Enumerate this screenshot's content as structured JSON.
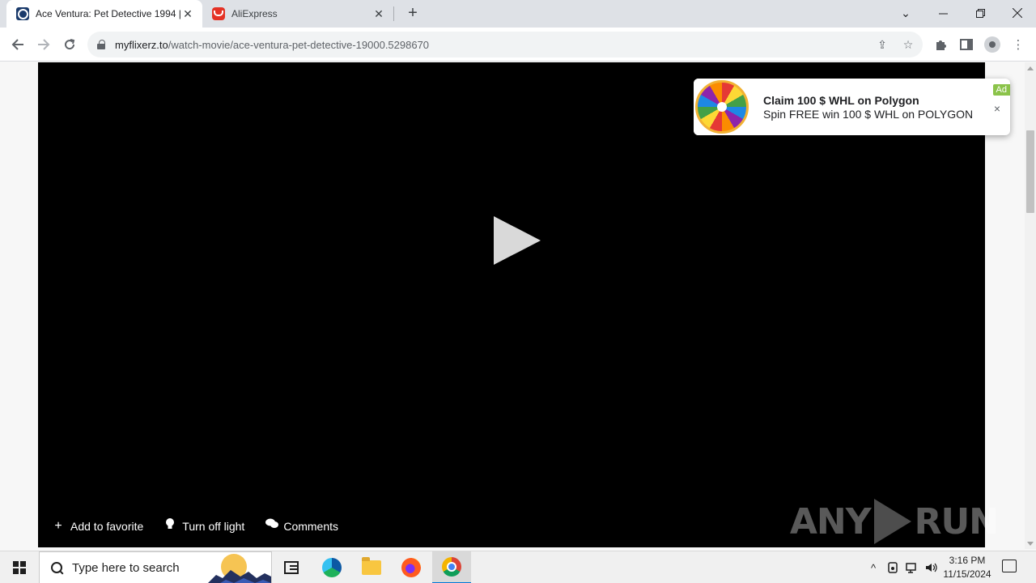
{
  "browser": {
    "tabs": [
      {
        "label": "Ace Ventura: Pet Detective 1994 |",
        "favicon": "movie-site-icon",
        "active": true
      },
      {
        "label": "AliExpress",
        "favicon": "aliexpress-icon",
        "active": false
      }
    ],
    "new_tab_label": "+",
    "url_domain": "myflixerz.to",
    "url_path": "/watch-movie/ace-ventura-pet-detective-19000.5298670"
  },
  "player": {
    "actions": [
      {
        "label": "Add to favorite",
        "icon": "plus-icon"
      },
      {
        "label": "Turn off light",
        "icon": "lightbulb-icon"
      },
      {
        "label": "Comments",
        "icon": "comments-icon"
      }
    ],
    "watermark_left": "ANY",
    "watermark_right": "RUN"
  },
  "ad": {
    "title": "Claim  100 $ WHL on Polygon",
    "subtitle": "Spin FREE win 100 $ WHL on POLYGON",
    "badge": "Ad",
    "close": "×"
  },
  "taskbar": {
    "search_placeholder": "Type here to search",
    "time": "3:16 PM",
    "date": "11/15/2024"
  },
  "colors": {
    "player_bg": "#000000",
    "ad_badge": "#8bc34a",
    "accent": "#0078d7"
  }
}
